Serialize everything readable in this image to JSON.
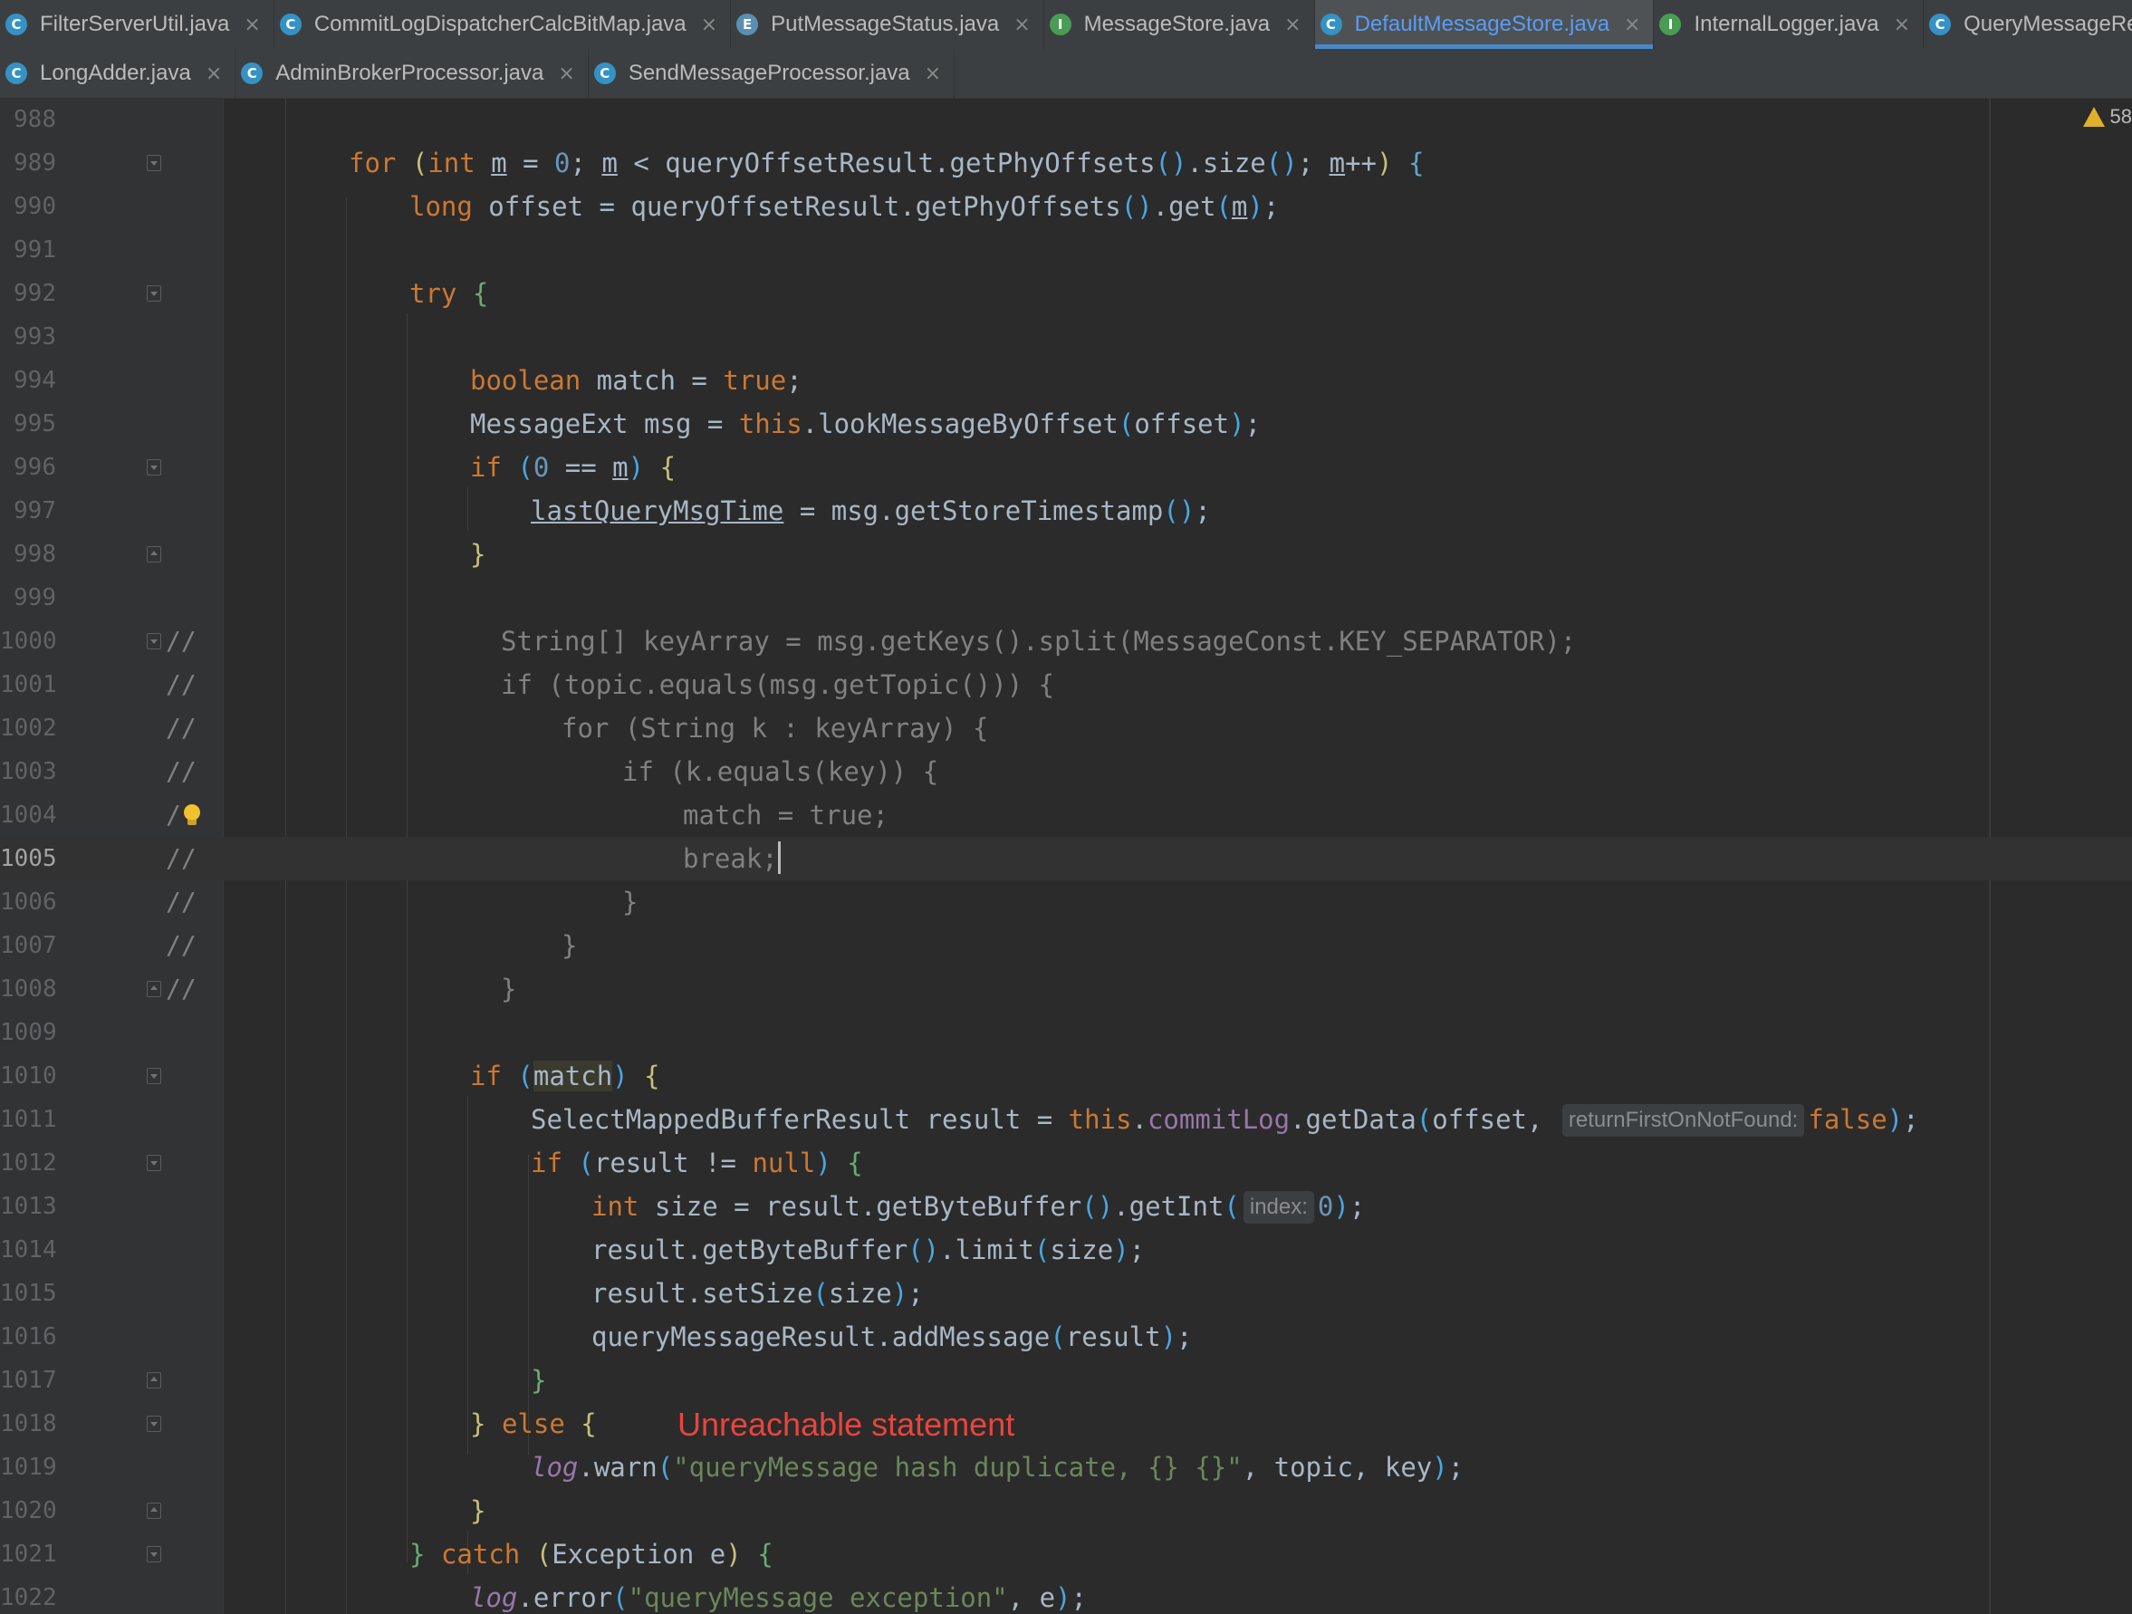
{
  "tabs_row1": [
    {
      "icon": "C",
      "kind": "class",
      "label": "FilterServerUtil.java"
    },
    {
      "icon": "C",
      "kind": "class",
      "label": "CommitLogDispatcherCalcBitMap.java"
    },
    {
      "icon": "E",
      "kind": "enum",
      "label": "PutMessageStatus.java"
    },
    {
      "icon": "I",
      "kind": "interface",
      "label": "MessageStore.java"
    },
    {
      "icon": "C",
      "kind": "class",
      "label": "DefaultMessageStore.java",
      "active": true
    },
    {
      "icon": "I",
      "kind": "interface",
      "label": "InternalLogger.java"
    },
    {
      "icon": "C",
      "kind": "class",
      "label": "QueryMessageResult.java"
    }
  ],
  "tabs_row2": [
    {
      "icon": "C",
      "kind": "class",
      "label": "LongAdder.java"
    },
    {
      "icon": "C",
      "kind": "class",
      "label": "AdminBrokerProcessor.java"
    },
    {
      "icon": "C",
      "kind": "class",
      "label": "SendMessageProcessor.java"
    }
  ],
  "editor": {
    "warning_count": "58",
    "inspection_message": "Unreachable statement",
    "hint_return_first": "returnFirstOnNotFound:",
    "hint_index": "index:",
    "line_numbers": [
      "988",
      "989",
      "990",
      "991",
      "992",
      "993",
      "994",
      "995",
      "996",
      "997",
      "998",
      "999",
      "1000",
      "1001",
      "1002",
      "1003",
      "1004",
      "1005",
      "1006",
      "1007",
      "1008",
      "1009",
      "1010",
      "1011",
      "1012",
      "1013",
      "1014",
      "1015",
      "1016",
      "1017",
      "1018",
      "1019",
      "1020",
      "1021",
      "1022"
    ],
    "current_line": "1005"
  },
  "colors": {
    "background": "#2b2b2b",
    "keyword": "#cc7832",
    "number": "#6897bb",
    "string": "#6a8759",
    "comment": "#808080",
    "field": "#9876aa",
    "error": "#e8453c",
    "active_tab": "#589df6"
  },
  "icons": {
    "class_icon": "circle-c",
    "enum_icon": "circle-e",
    "interface_icon": "circle-i",
    "close_icon": "x",
    "warning_icon": "triangle",
    "bulb_icon": "lightbulb",
    "fold_icon": "fold-marker"
  }
}
